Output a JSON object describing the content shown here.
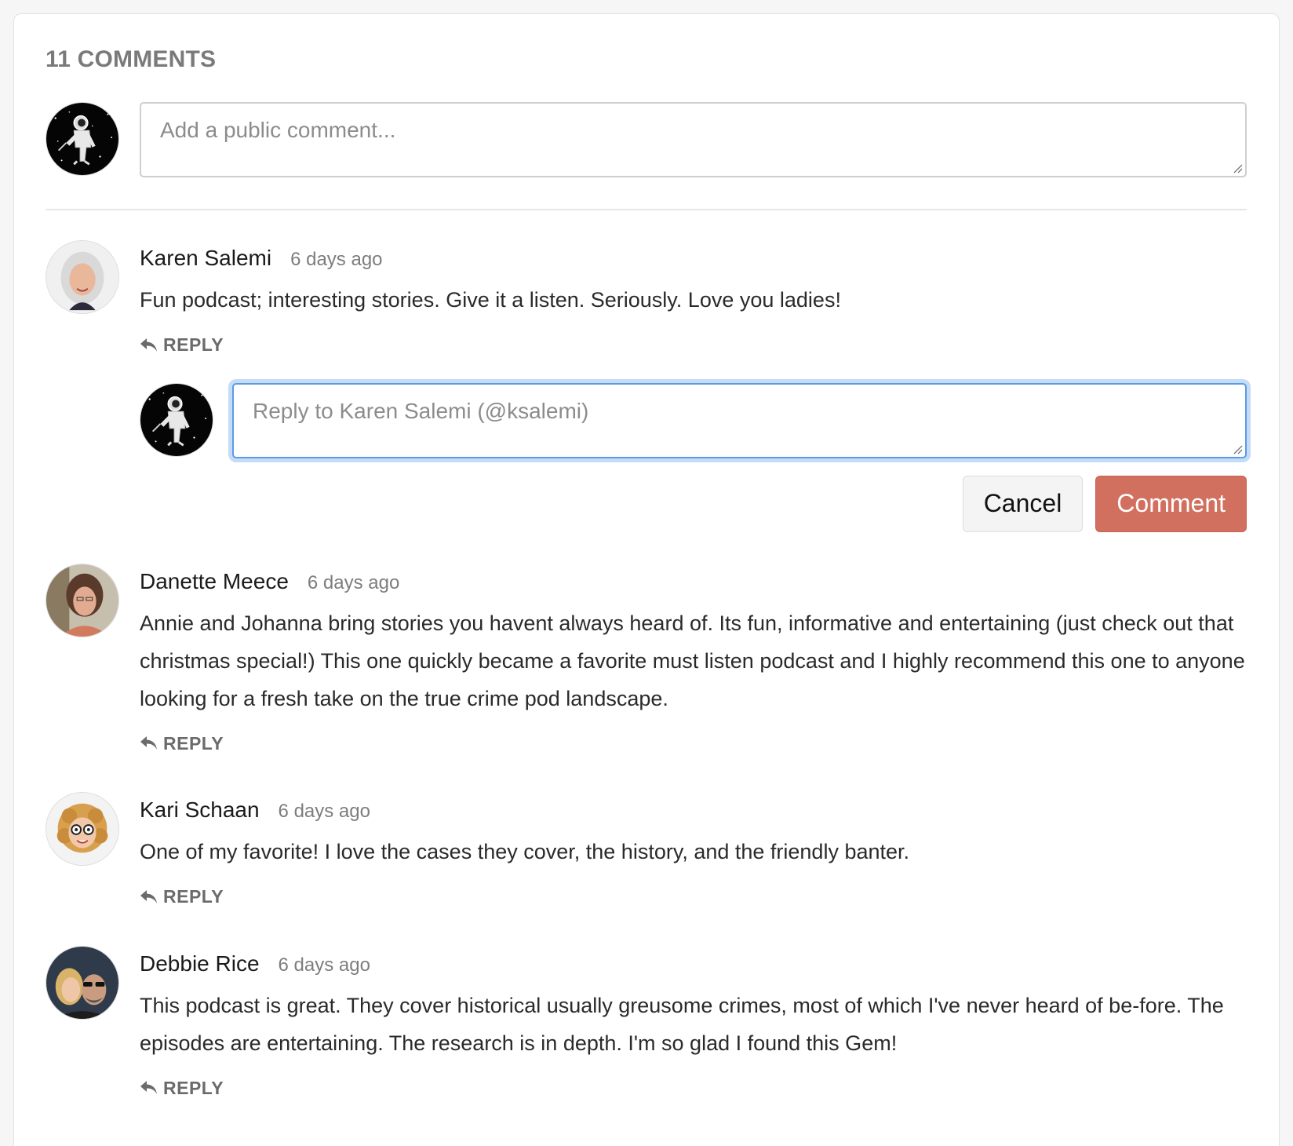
{
  "header": {
    "comment_count_title": "11 COMMENTS"
  },
  "composer": {
    "placeholder": "Add a public comment..."
  },
  "comments": [
    {
      "author": "Karen Salemi",
      "time": "6 days ago",
      "text": "Fun podcast; interesting stories. Give it a listen. Seriously. Love you ladies!",
      "reply_label": "REPLY"
    },
    {
      "author": "Danette Meece",
      "time": "6 days ago",
      "text": "Annie and Johanna bring stories you havent always heard of. Its fun, informative and entertaining (just check out that christmas special!) This one quickly became a favorite must listen podcast and I highly recommend this one to anyone looking for a fresh take on the true crime pod landscape.",
      "reply_label": "REPLY"
    },
    {
      "author": "Kari Schaan",
      "time": "6 days ago",
      "text": "One of my favorite! I love the cases they cover, the history, and the friendly banter.",
      "reply_label": "REPLY"
    },
    {
      "author": "Debbie Rice",
      "time": "6 days ago",
      "text": "This podcast is great. They cover historical usually greusome crimes, most of which I've never heard of be-fore. The episodes are entertaining. The research is in depth. I'm so glad I found this Gem!",
      "reply_label": "REPLY"
    }
  ],
  "reply_box": {
    "placeholder": "Reply to Karen Salemi (@ksalemi)",
    "cancel_label": "Cancel",
    "comment_label": "Comment"
  },
  "colors": {
    "accent": "#d2705f",
    "focus": "#5b9be8"
  }
}
